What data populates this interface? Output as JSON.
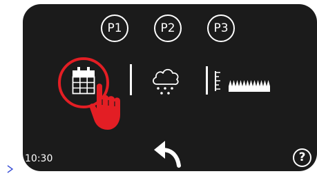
{
  "programs": [
    {
      "label": "P1"
    },
    {
      "label": "P2"
    },
    {
      "label": "P3"
    }
  ],
  "modes": [
    {
      "icon": "calendar-icon"
    },
    {
      "icon": "rain-cloud-icon"
    },
    {
      "icon": "mowing-height-icon"
    }
  ],
  "selected_mode": "calendar-icon",
  "status": {
    "time": "10:30"
  },
  "help": {
    "label": "?"
  },
  "colors": {
    "panel": "#1b1b1b",
    "foreground": "#ffffff",
    "highlight": "#e31e24"
  }
}
